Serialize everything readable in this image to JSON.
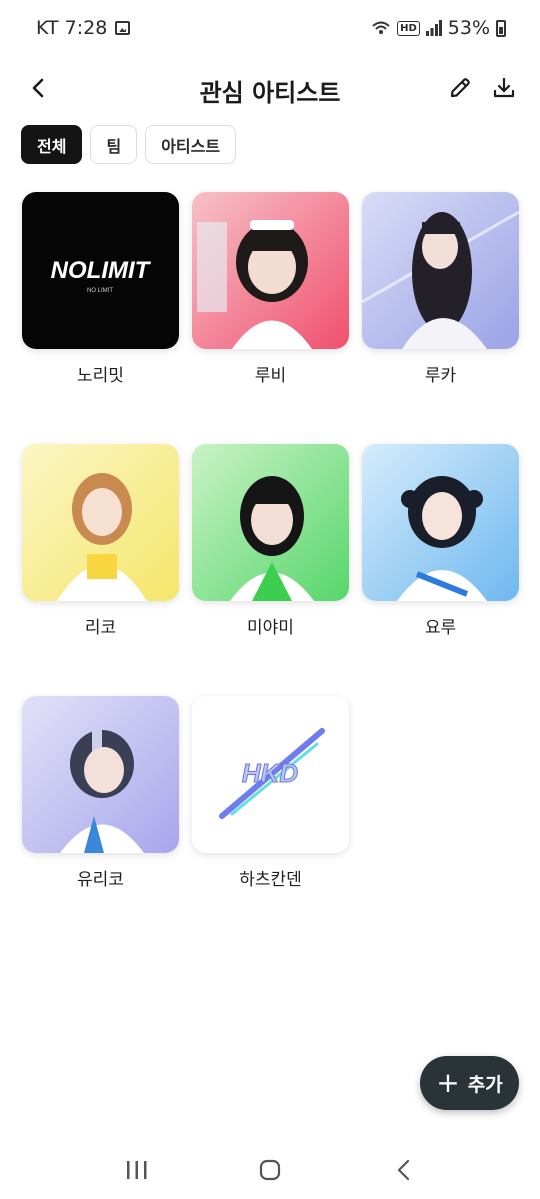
{
  "status": {
    "carrier_time": "KT 7:28",
    "battery": "53%",
    "hd_badge": "HD",
    "icons": [
      "gallery-icon",
      "wifi-calling-icon",
      "signal-icon",
      "battery-icon"
    ]
  },
  "header": {
    "title": "관심 아티스트",
    "actions": [
      "back-icon",
      "edit-pencil-icon",
      "download-icon"
    ]
  },
  "filters": {
    "all": "전체",
    "team": "팀",
    "artist": "아티스트",
    "selected": "전체"
  },
  "logos": {
    "nolimit_text": "NOLIMIT",
    "nolimit_sub": "NO LIMIT",
    "hk_text": "HKD"
  },
  "artists": [
    {
      "name": "노리밋",
      "type": "logo-dark"
    },
    {
      "name": "루비",
      "type": "photo",
      "accent": "#f0506e"
    },
    {
      "name": "루카",
      "type": "photo",
      "accent": "#9aa3e6"
    },
    {
      "name": "리코",
      "type": "photo",
      "accent": "#f5e66a"
    },
    {
      "name": "미야미",
      "type": "photo",
      "accent": "#57d66b"
    },
    {
      "name": "요루",
      "type": "photo",
      "accent": "#6fb8ef"
    },
    {
      "name": "유리코",
      "type": "photo",
      "accent": "#a8a6ec"
    },
    {
      "name": "하츠칸덴",
      "type": "logo-light"
    }
  ],
  "fab": {
    "label": "추가",
    "icon": "plus-icon"
  },
  "colors": {
    "chip_active_bg": "#141414",
    "fab_bg": "#2a3338"
  }
}
